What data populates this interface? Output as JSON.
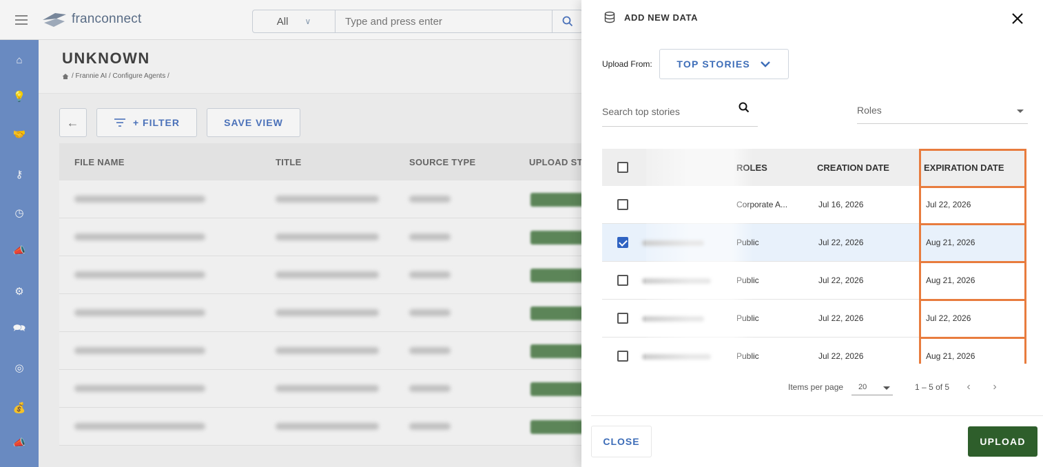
{
  "header": {
    "logo_text": "franconnect",
    "search_scope": "All",
    "search_placeholder": "Type and press enter"
  },
  "sidebar": {
    "items": [
      {
        "icon": "home-icon",
        "glyph": "⌂"
      },
      {
        "icon": "lightbulb-icon",
        "glyph": "💡"
      },
      {
        "icon": "handshake-icon",
        "glyph": "🤝"
      },
      {
        "icon": "key-icon",
        "glyph": "⚷"
      },
      {
        "icon": "gauge-icon",
        "glyph": "◷"
      },
      {
        "icon": "megaphone-icon",
        "glyph": "📣"
      },
      {
        "icon": "gear-icon",
        "glyph": "⚙"
      },
      {
        "icon": "chat-icon",
        "glyph": "🗪"
      },
      {
        "icon": "lifebuoy-icon",
        "glyph": "◎"
      },
      {
        "icon": "money-bag-icon",
        "glyph": "💰"
      },
      {
        "icon": "megaphone-icon",
        "glyph": "📣"
      }
    ]
  },
  "page": {
    "title": "UNKNOWN",
    "breadcrumb": "/ Frannie AI / Configure Agents /"
  },
  "toolbar": {
    "filter_label": "+ FILTER",
    "save_view_label": "SAVE VIEW"
  },
  "grid": {
    "columns": [
      "FILE NAME",
      "TITLE",
      "SOURCE TYPE",
      "UPLOAD ST"
    ]
  },
  "drawer": {
    "title": "ADD NEW DATA",
    "upload_from_label": "Upload From:",
    "source_value": "TOP STORIES",
    "search_placeholder": "Search top stories",
    "roles_placeholder": "Roles",
    "columns": {
      "roles": "ROLES",
      "creation_date": "CREATION DATE",
      "expiration_date": "EXPIRATION DATE"
    },
    "rows": [
      {
        "checked": false,
        "role": "Corporate A...",
        "creation": "Jul 16, 2026",
        "expiration": "Jul 22, 2026"
      },
      {
        "checked": true,
        "role": "Public",
        "creation": "Jul 22, 2026",
        "expiration": "Aug 21, 2026"
      },
      {
        "checked": false,
        "role": "Public",
        "creation": "Jul 22, 2026",
        "expiration": "Aug 21, 2026"
      },
      {
        "checked": false,
        "role": "Public",
        "creation": "Jul 22, 2026",
        "expiration": "Jul 22, 2026"
      },
      {
        "checked": false,
        "role": "Public",
        "creation": "Jul 22, 2026",
        "expiration": "Aug 21, 2026"
      }
    ],
    "paginator": {
      "items_per_page_label": "Items per page",
      "items_per_page": "20",
      "range": "1 – 5 of 5"
    },
    "close_label": "CLOSE",
    "upload_label": "UPLOAD"
  },
  "colors": {
    "accent_blue": "#3d6db8",
    "sidebar_bg": "#6c8fc9",
    "upload_green": "#2e5e2b",
    "highlight_orange": "#e87c3e"
  }
}
